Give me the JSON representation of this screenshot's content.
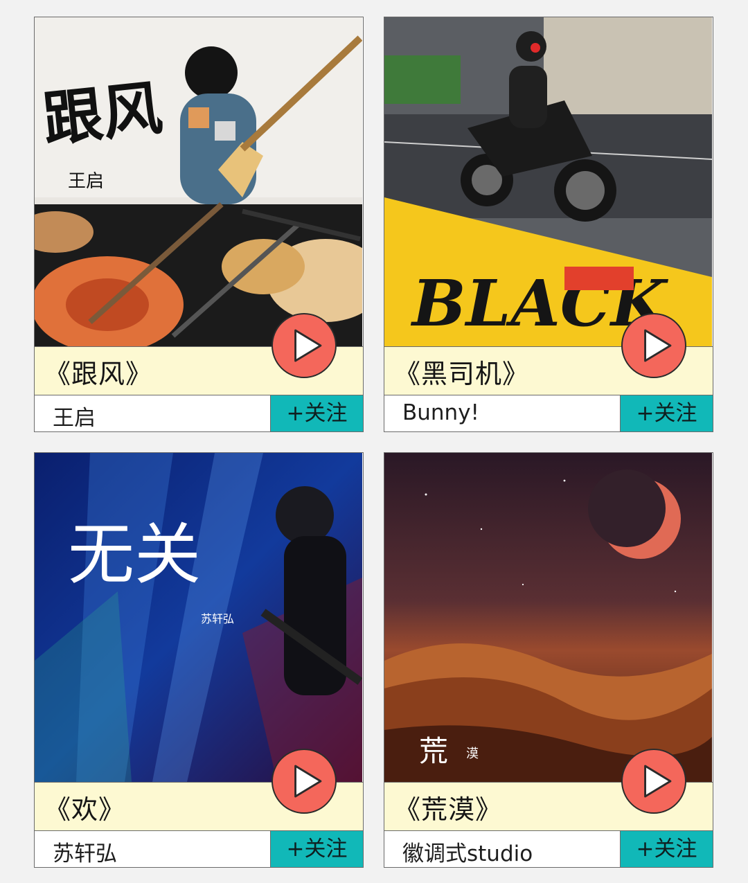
{
  "cards": [
    {
      "title": "《跟风》",
      "artist": "王启",
      "follow_label": "+关注",
      "cover": {
        "main_text": "跟风",
        "sub_text": "王启"
      }
    },
    {
      "title": "《黑司机》",
      "artist": "Bunny!",
      "follow_label": "+关注",
      "cover": {
        "logo_text": "BLACK"
      }
    },
    {
      "title": "《欢》",
      "artist": "苏轩弘",
      "follow_label": "+关注",
      "cover": {
        "main_text": "无关",
        "sub_text": "苏轩弘"
      }
    },
    {
      "title": "《荒漠》",
      "artist": "徽调式studio",
      "follow_label": "+关注",
      "cover": {
        "main_text": "荒",
        "sub_text": "漠"
      }
    }
  ],
  "colors": {
    "title_bar_bg": "#fdf9d2",
    "follow_bg": "#11b8b8",
    "play_bg": "#f4675b"
  }
}
